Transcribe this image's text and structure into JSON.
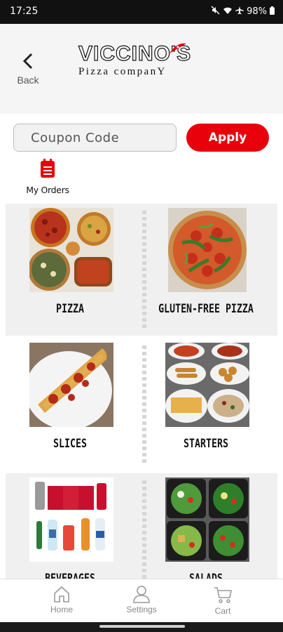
{
  "status": {
    "time": "17:25",
    "battery": "98%"
  },
  "header": {
    "back_label": "Back",
    "logo_main": "VICCINO'S",
    "logo_sub": "Pizza companY"
  },
  "coupon": {
    "placeholder": "Coupon Code",
    "apply_label": "Apply"
  },
  "orders": {
    "label": "My Orders"
  },
  "categories": [
    {
      "label": "PIZZA"
    },
    {
      "label": "GLUTEN-FREE PIZZA"
    },
    {
      "label": "SLICES"
    },
    {
      "label": "STARTERS"
    },
    {
      "label": "BEVERAGES"
    },
    {
      "label": "SALADS"
    }
  ],
  "nav": {
    "home": "Home",
    "settings": "Settings",
    "cart": "Cart"
  },
  "colors": {
    "accent": "#e8000b",
    "status_bar": "#111111"
  }
}
